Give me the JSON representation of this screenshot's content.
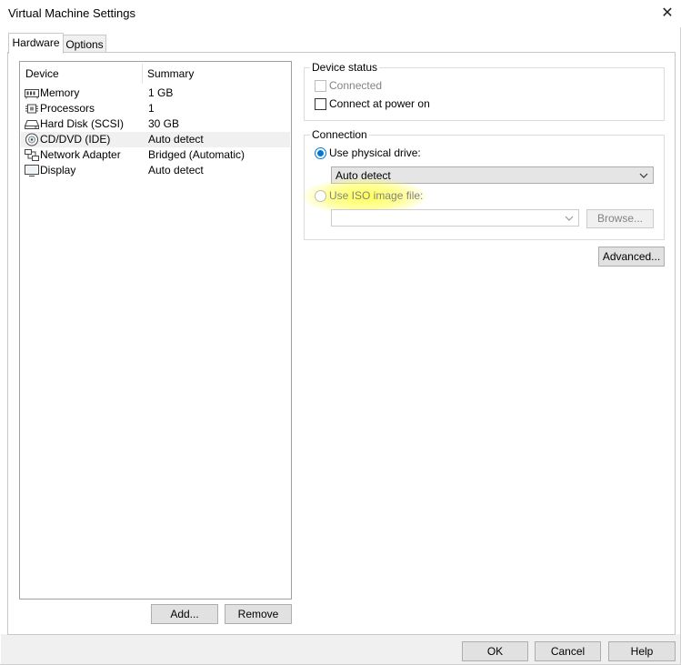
{
  "window": {
    "title": "Virtual Machine Settings",
    "close_glyph": "✕"
  },
  "tabs": [
    {
      "label": "Hardware",
      "active": true
    },
    {
      "label": "Options",
      "active": false
    }
  ],
  "device_list": {
    "columns": [
      "Device",
      "Summary"
    ],
    "rows": [
      {
        "name": "Memory",
        "summary": "1 GB",
        "icon": "memory-icon"
      },
      {
        "name": "Processors",
        "summary": "1",
        "icon": "processor-icon"
      },
      {
        "name": "Hard Disk (SCSI)",
        "summary": "30 GB",
        "icon": "hard-disk-icon"
      },
      {
        "name": "CD/DVD (IDE)",
        "summary": "Auto detect",
        "icon": "cd-dvd-icon",
        "selected": true
      },
      {
        "name": "Network Adapter",
        "summary": "Bridged (Automatic)",
        "icon": "network-adapter-icon"
      },
      {
        "name": "Display",
        "summary": "Auto detect",
        "icon": "display-icon"
      }
    ],
    "add_label": "Add...",
    "remove_label": "Remove"
  },
  "device_status": {
    "label": "Device status",
    "connected_label": "Connected",
    "connected_checked": false,
    "connected_enabled": false,
    "power_on_label": "Connect at power on",
    "power_on_checked": false
  },
  "connection": {
    "label": "Connection",
    "physical_label": "Use physical drive:",
    "physical_selected": true,
    "physical_value": "Auto detect",
    "iso_label": "Use ISO image file:",
    "iso_selected": false,
    "iso_value": "",
    "browse_label": "Browse..."
  },
  "advanced_label": "Advanced...",
  "footer": {
    "ok_label": "OK",
    "cancel_label": "Cancel",
    "help_label": "Help"
  },
  "colors": {
    "accent": "#0078d7",
    "highlight": "#ffff3c",
    "selected_row": "#f0f0f0"
  }
}
